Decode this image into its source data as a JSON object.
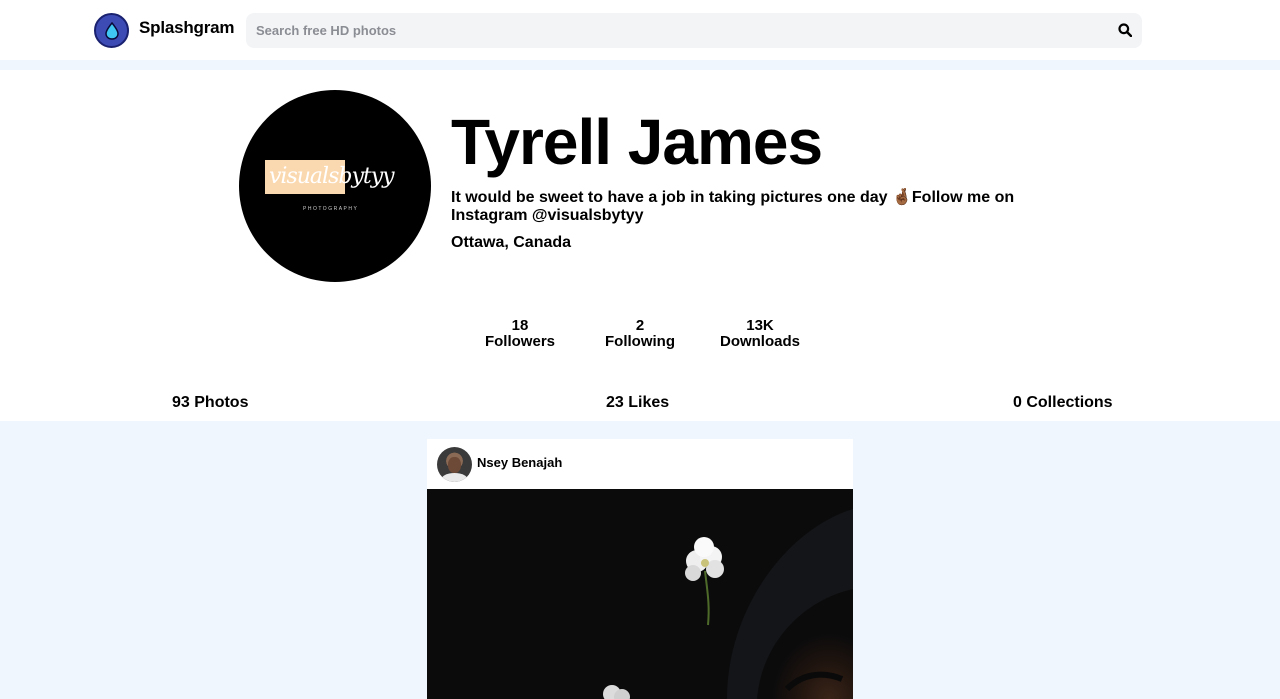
{
  "header": {
    "brand": "Splashgram",
    "search_placeholder": "Search free HD photos"
  },
  "profile": {
    "name": "Tyrell James",
    "bio": "It would be sweet to have a job in taking pictures one day 🤞🏾Follow me on Instagram @visualsbytyy",
    "location": "Ottawa, Canada",
    "avatar_text": "visualsbytyy",
    "avatar_subtext": "PHOTOGRAPHY"
  },
  "stats": [
    {
      "value": "18",
      "label": "Followers"
    },
    {
      "value": "2",
      "label": "Following"
    },
    {
      "value": "13K",
      "label": "Downloads"
    }
  ],
  "tabs": [
    {
      "label": "93 Photos"
    },
    {
      "label": "23 Likes"
    },
    {
      "label": "0 Collections"
    }
  ],
  "feed": [
    {
      "user": "Nsey Benajah"
    }
  ]
}
